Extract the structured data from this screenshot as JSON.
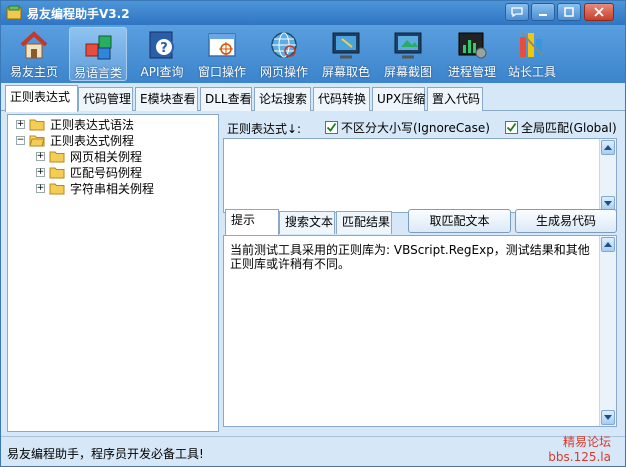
{
  "window": {
    "title": "易友编程助手V3.2"
  },
  "toolbar": {
    "items": [
      {
        "label": "易友主页",
        "icon": "home-icon"
      },
      {
        "label": "易语言类",
        "icon": "blocks-icon"
      },
      {
        "label": "API查询",
        "icon": "help-icon"
      },
      {
        "label": "窗口操作",
        "icon": "window-icon"
      },
      {
        "label": "网页操作",
        "icon": "web-icon"
      },
      {
        "label": "屏幕取色",
        "icon": "color-picker-icon"
      },
      {
        "label": "屏幕截图",
        "icon": "screenshot-icon"
      },
      {
        "label": "进程管理",
        "icon": "process-icon"
      },
      {
        "label": "站长工具",
        "icon": "tools-icon"
      }
    ]
  },
  "tabs": [
    "正则表达式",
    "代码管理",
    "E模块查看",
    "DLL查看",
    "论坛搜索",
    "代码转换",
    "UPX压缩",
    "置入代码"
  ],
  "tree": {
    "items": [
      {
        "label": "正则表达式语法",
        "toggle": "+"
      },
      {
        "label": "正则表达式例程",
        "toggle": "−"
      },
      {
        "label": "网页相关例程",
        "toggle": "+"
      },
      {
        "label": "匹配号码例程",
        "toggle": "+"
      },
      {
        "label": "字符串相关例程",
        "toggle": "+"
      }
    ]
  },
  "regex": {
    "label": "正则表达式↓:",
    "ignore_case_label": "不区分大小写(IgnoreCase)",
    "ignore_case_checked": true,
    "global_label": "全局匹配(Global)",
    "global_checked": true,
    "value": ""
  },
  "subtabs": [
    "提示",
    "搜索文本",
    "匹配结果"
  ],
  "buttons": {
    "get_match": "取匹配文本",
    "generate": "生成易代码"
  },
  "result": {
    "text": "当前测试工具采用的正则库为: VBScript.RegExp，测试结果和其他正则库或许稍有不同。"
  },
  "status": {
    "text": "易友编程助手，程序员开发必备工具!"
  },
  "watermark": {
    "line1": "精易论坛",
    "line2": "bbs.125.la"
  },
  "colors": {
    "titlebar": "#3a82cc",
    "toolbar": "#4a92d6",
    "watermark": "#d8392c"
  }
}
